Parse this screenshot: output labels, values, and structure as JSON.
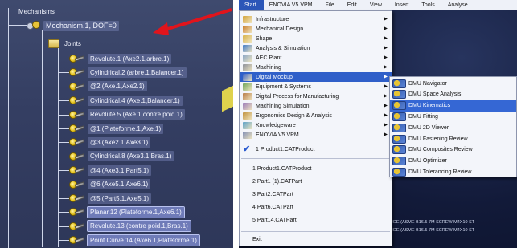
{
  "tree": {
    "root_label": "Mechanisms",
    "mechanism_label": "Mechanism.1, DOF=0",
    "joints_folder_label": "Joints",
    "joints": [
      "Revolute.1 (Axe2.1,arbre.1)",
      "Cylindrical.2 (arbre.1,Balancer.1)",
      "@2 (Axe.1,Axe2.1)",
      "Cylindrical.4 (Axe.1,Balancer.1)",
      "Revolute.5 (Axe.1,contre poid.1)",
      "@1 (Plateforme.1,Axe.1)",
      "@3 (Axe2.1,Axe3.1)",
      "Cylindrical.8 (Axe3.1,Bras.1)",
      "@4 (Axe3.1,Part5.1)",
      "@6 (Axe5.1,Axe6.1)",
      "@5 (Part5.1,Axe5.1)",
      "Planar.12 (Plateforme.1,Axe6.1)",
      "Revolute.13 (contre poid.1,Bras.1)",
      "Point Curve.14 (Axe6.1,Plateforme.1)"
    ],
    "colors": {
      "background": "#3a4468",
      "label_bg": "#6f7bb8",
      "arrow": "#e0141c"
    }
  },
  "menubar": {
    "items": [
      "Start",
      "ENOVIA V5 VPM",
      "File",
      "Edit",
      "View",
      "Insert",
      "Tools",
      "Analyse"
    ],
    "active_index": 0
  },
  "start_menu": {
    "items": [
      {
        "label": "Infrastructure",
        "icon": "infrastructure-icon",
        "submenu": true
      },
      {
        "label": "Mechanical Design",
        "icon": "mechanical-design-icon",
        "submenu": true
      },
      {
        "label": "Shape",
        "icon": "shape-icon",
        "submenu": true
      },
      {
        "label": "Analysis & Simulation",
        "icon": "analysis-icon",
        "submenu": true
      },
      {
        "label": "AEC Plant",
        "icon": "aec-plant-icon",
        "submenu": true
      },
      {
        "label": "Machining",
        "icon": "machining-icon",
        "submenu": true
      },
      {
        "label": "Digital Mockup",
        "icon": "digital-mockup-icon",
        "submenu": true
      },
      {
        "label": "Equipment & Systems",
        "icon": "equipment-icon",
        "submenu": true
      },
      {
        "label": "Digital Process for Manufacturing",
        "icon": "process-icon",
        "submenu": true
      },
      {
        "label": "Machining Simulation",
        "icon": "machining-sim-icon",
        "submenu": true
      },
      {
        "label": "Ergonomics Design & Analysis",
        "icon": "ergonomics-icon",
        "submenu": true
      },
      {
        "label": "Knowledgeware",
        "icon": "knowledgeware-icon",
        "submenu": true
      },
      {
        "label": "ENOVIA V5 VPM",
        "icon": "enovia-icon",
        "submenu": true
      }
    ],
    "active_index": 6,
    "recent_checked": "1 Product1.CATProduct",
    "recent_files": [
      "1 Product1.CATProduct",
      "2 Part1 (1).CATPart",
      "3 Part2.CATPart",
      "4 Part6.CATPart",
      "5 Part14.CATPart"
    ],
    "exit_label": "Exit"
  },
  "dmu_submenu": {
    "items": [
      "DMU Navigator",
      "DMU Space Analysis",
      "DMU Kinematics",
      "DMU Fitting",
      "DMU 2D Viewer",
      "DMU Fastening Review",
      "DMU Composites Review",
      "DMU Optimizer",
      "DMU Tolerancing Review"
    ],
    "active_index": 2
  },
  "viewport": {
    "command_lines": [
      "ANGE (ASME B16.5 7M SCREW M4X10 ST",
      "ANGE (ASME B16.5 7M SCREW M4X10 ST"
    ]
  }
}
